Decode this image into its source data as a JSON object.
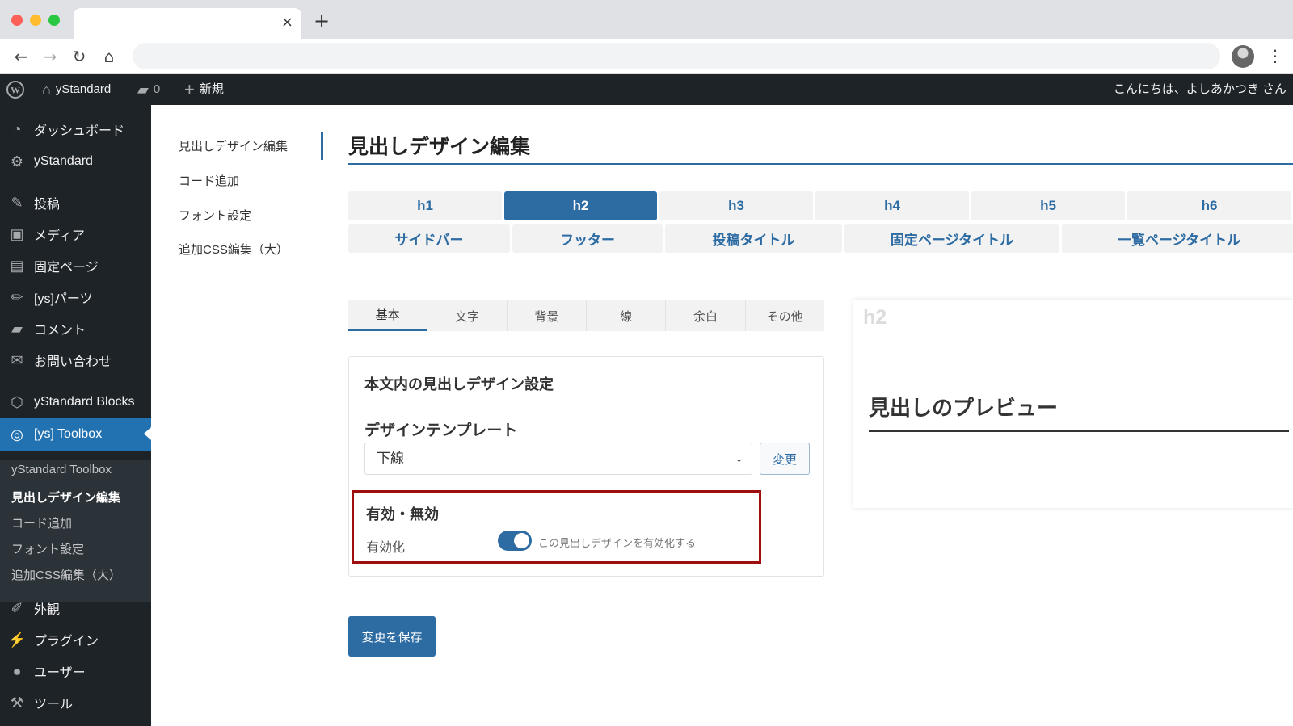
{
  "browser": {
    "tab_close": "×",
    "new_tab": "+"
  },
  "adminbar": {
    "site_name": "yStandard",
    "comments_count": "0",
    "new_label": "新規",
    "greeting": "こんにちは、よしあかつき さん"
  },
  "sidebar": {
    "items": [
      {
        "label": "ダッシュボード",
        "icon": "dashboard-icon"
      },
      {
        "label": "yStandard",
        "icon": "gear-icon"
      },
      {
        "label": "投稿",
        "icon": "pin-icon"
      },
      {
        "label": "メディア",
        "icon": "media-icon"
      },
      {
        "label": "固定ページ",
        "icon": "page-icon"
      },
      {
        "label": "[ys]パーツ",
        "icon": "pencil-icon"
      },
      {
        "label": "コメント",
        "icon": "comment-icon"
      },
      {
        "label": "お問い合わせ",
        "icon": "mail-icon"
      },
      {
        "label": "yStandard Blocks",
        "icon": "cube-icon"
      },
      {
        "label": "[ys] Toolbox",
        "icon": "toolbox-icon"
      },
      {
        "label": "外観",
        "icon": "brush-icon"
      },
      {
        "label": "プラグイン",
        "icon": "plugin-icon"
      },
      {
        "label": "ユーザー",
        "icon": "user-icon"
      },
      {
        "label": "ツール",
        "icon": "wrench-icon"
      }
    ],
    "submenu": [
      "yStandard Toolbox",
      "見出しデザイン編集",
      "コード追加",
      "フォント設定",
      "追加CSS編集（大）"
    ],
    "accent_color": "#2271b1"
  },
  "toolbox_nav": [
    "見出しデザイン編集",
    "コード追加",
    "フォント設定",
    "追加CSS編集（大）"
  ],
  "page": {
    "title": "見出しデザイン編集",
    "heading_tags_row1": [
      "h1",
      "h2",
      "h3",
      "h4",
      "h5",
      "h6"
    ],
    "heading_tags_row2": [
      "サイドバー",
      "フッター",
      "投稿タイトル",
      "固定ページタイトル",
      "一覧ページタイトル"
    ],
    "subtabs": [
      "基本",
      "文字",
      "背景",
      "線",
      "余白",
      "その他"
    ],
    "panel_title": "本文内の見出しデザイン設定",
    "template_label": "デザインテンプレート",
    "template_value": "下線",
    "select_chevron": "⌄",
    "change_button": "変更",
    "enable_title": "有効・無効",
    "enable_label": "有効化",
    "enable_description": "この見出しデザインを有効化する",
    "enabled": true,
    "save_button": "変更を保存",
    "accent_color": "#2d6ba3"
  },
  "preview": {
    "tag": "h2",
    "heading": "見出しのプレビュー"
  }
}
